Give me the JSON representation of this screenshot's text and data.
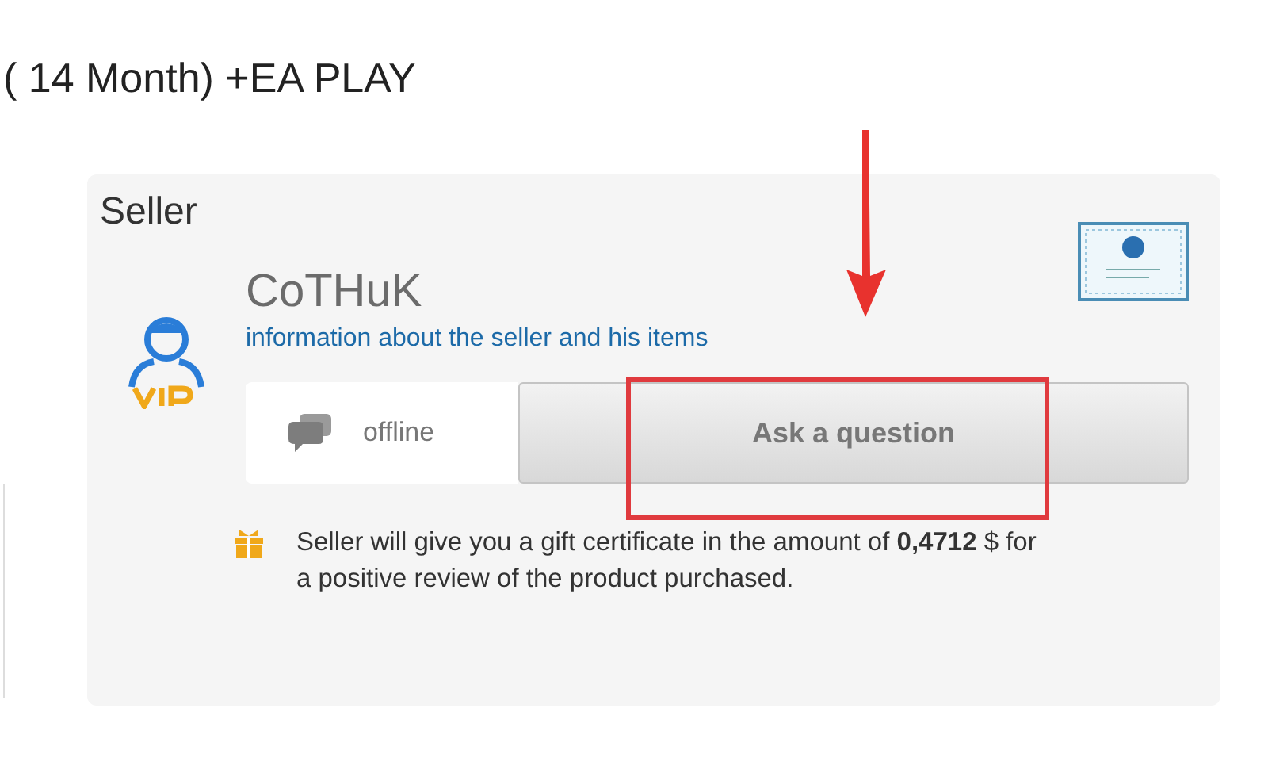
{
  "product_title": "( 14 Month) +EA PLAY",
  "seller": {
    "heading": "Seller",
    "name": "CoTHuK",
    "info_link": "information about the seller and his items",
    "vip": true,
    "status": "offline",
    "ask_button": "Ask a question",
    "gift_text": "Seller will give you a gift certificate in the amount of **0,4712** $ for a positive review of the product purchased."
  }
}
